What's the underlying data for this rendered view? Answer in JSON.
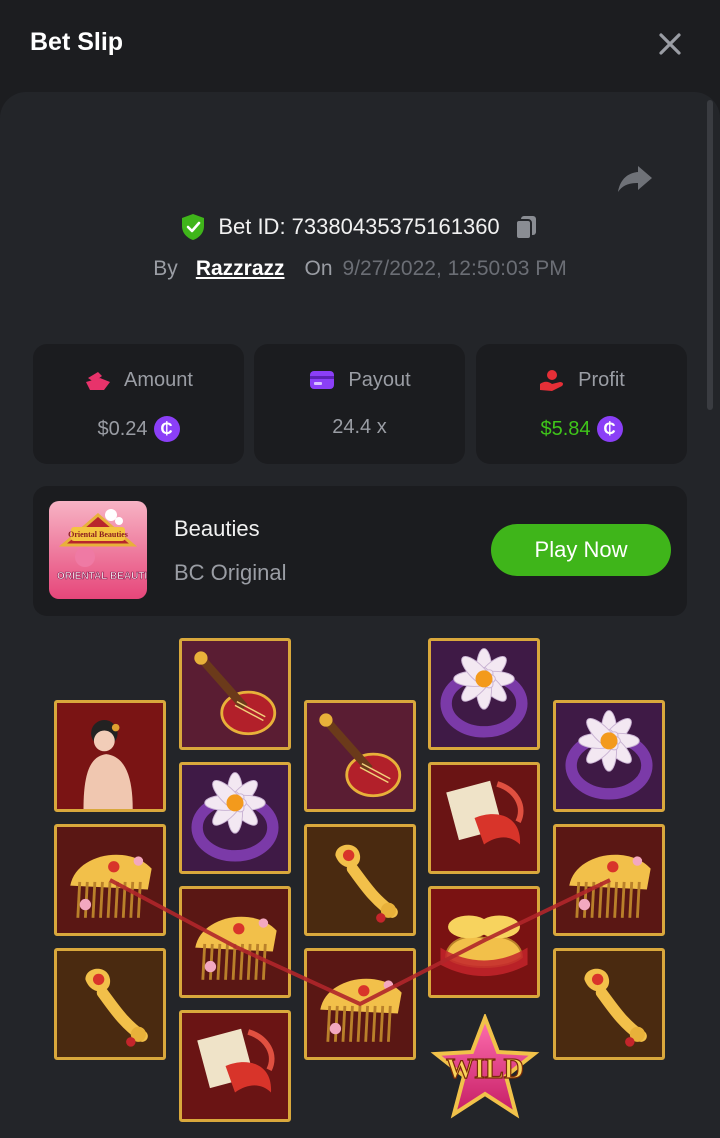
{
  "header": {
    "title": "Bet Slip"
  },
  "bet": {
    "id_text": "Bet ID: 73380435375161360",
    "by_label": "By",
    "username": "Razzrazz",
    "on_label": "On",
    "date": "9/27/2022, 12:50:03 PM"
  },
  "stats": {
    "amount": {
      "label": "Amount",
      "value": "$0.24"
    },
    "payout": {
      "label": "Payout",
      "value": "24.4 x"
    },
    "profit": {
      "label": "Profit",
      "value": "$5.84"
    }
  },
  "coin_symbol": "₵",
  "game": {
    "name": "Beauties",
    "provider": "BC Original",
    "play_label": "Play Now",
    "thumb_text_top": "Oriental Beauties",
    "thumb_text": "ORIENTAL BEAUTIES"
  },
  "reels": [
    [
      "beauty",
      "comb",
      "scepter"
    ],
    [
      "lute",
      "lotus-ring",
      "comb",
      "koi-fan"
    ],
    [
      "lute",
      "scepter",
      "comb"
    ],
    [
      "lotus-ring",
      "koi-fan",
      "gold-ingots",
      "wild"
    ],
    [
      "lotus-ring",
      "comb",
      "scepter"
    ]
  ],
  "wild_text": "WILD",
  "colors": {
    "accent_green": "#3fb51a",
    "coin_purple": "#8b3ff7",
    "profit_green": "#3fc51a",
    "tile_border": "#d9a83c",
    "win_line": "#b0262a"
  }
}
